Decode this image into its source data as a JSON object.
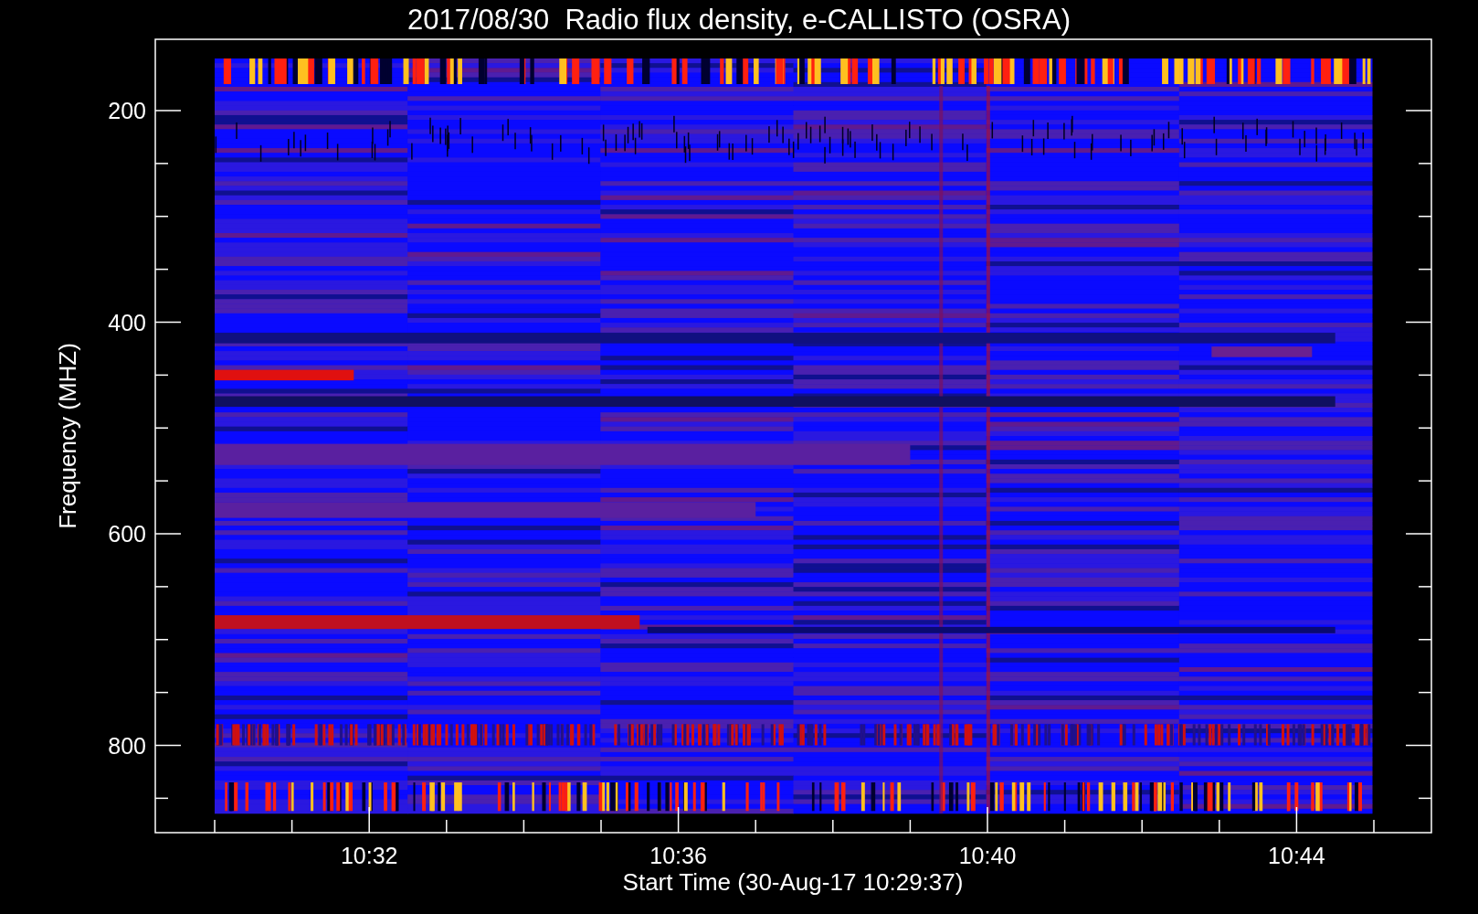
{
  "plot": {
    "title": "2017/08/30  Radio flux density, e-CALLISTO (OSRA)",
    "ylabel": "Frequency (MHZ)",
    "xlabel": "Start Time (30-Aug-17 10:29:37)",
    "y_tick_labels": [
      "200",
      "400",
      "600",
      "800"
    ],
    "x_tick_labels": [
      "10:32",
      "10:36",
      "10:40",
      "10:44"
    ]
  }
}
